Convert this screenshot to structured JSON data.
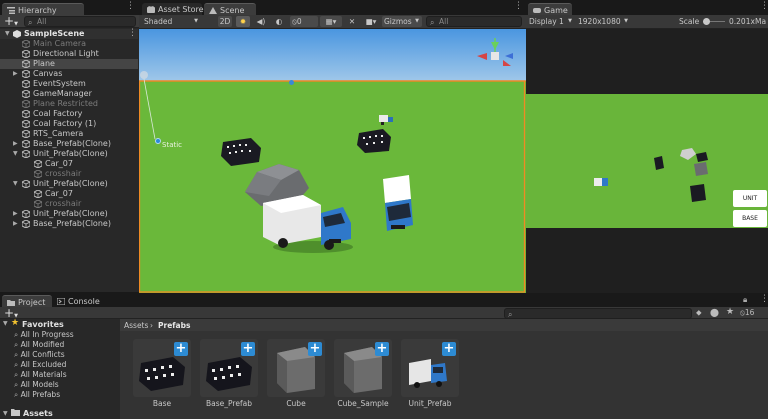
{
  "hierarchy": {
    "tab_label": "Hierarchy",
    "add_label": "+",
    "search_placeholder": "All",
    "scene_name": "SampleScene",
    "items": [
      {
        "label": "Main Camera",
        "dim": true
      },
      {
        "label": "Directional Light"
      },
      {
        "label": "Plane",
        "selected": true
      },
      {
        "label": "Canvas"
      },
      {
        "label": "EventSystem"
      },
      {
        "label": "GameManager"
      },
      {
        "label": "Plane Restricted",
        "dim": true
      },
      {
        "label": "Coal Factory"
      },
      {
        "label": "Coal Factory (1)"
      },
      {
        "label": "RTS_Camera"
      },
      {
        "label": "Base_Prefab(Clone)"
      },
      {
        "label": "Unit_Prefab(Clone)"
      },
      {
        "label": "Car_07"
      },
      {
        "label": "crosshair",
        "dim": true
      },
      {
        "label": "Unit_Prefab(Clone)"
      },
      {
        "label": "Car_07"
      },
      {
        "label": "crosshair",
        "dim": true
      },
      {
        "label": "Unit_Prefab(Clone)"
      },
      {
        "label": "Base_Prefab(Clone)"
      }
    ]
  },
  "scene": {
    "tab_asset_store": "Asset Store",
    "tab_scene": "Scene",
    "shading_mode": "Shaded",
    "mode_2d": "2D",
    "fx_count": "0",
    "gizmos_label": "Gizmos",
    "search_placeholder": "All",
    "static_label": "Static",
    "colors": {
      "ground": "#6fbf3c",
      "sky": "#5fa3dd",
      "selection": "#f08a24"
    }
  },
  "game": {
    "tab_label": "Game",
    "display": "Display 1",
    "resolution": "1920x1080",
    "scale_label": "Scale",
    "scale_value": "0.201x",
    "maximize_label": "Ma",
    "unit_button": "UNIT",
    "base_button": "BASE"
  },
  "project": {
    "tab_project": "Project",
    "tab_console": "Console",
    "add_label": "+",
    "hidden_count": "16",
    "favorites_label": "Favorites",
    "favorites": [
      "All In Progress",
      "All Modified",
      "All Conflicts",
      "All Excluded",
      "All Materials",
      "All Models",
      "All Prefabs"
    ],
    "assets_label": "Assets",
    "breadcrumb_root": "Assets",
    "breadcrumb_sep": "›",
    "breadcrumb_folder": "Prefabs",
    "items": [
      {
        "name": "Base",
        "kind": "building"
      },
      {
        "name": "Base_Prefab",
        "kind": "building"
      },
      {
        "name": "Cube",
        "kind": "cube"
      },
      {
        "name": "Cube_Sample",
        "kind": "cube"
      },
      {
        "name": "Unit_Prefab",
        "kind": "truck"
      }
    ]
  }
}
